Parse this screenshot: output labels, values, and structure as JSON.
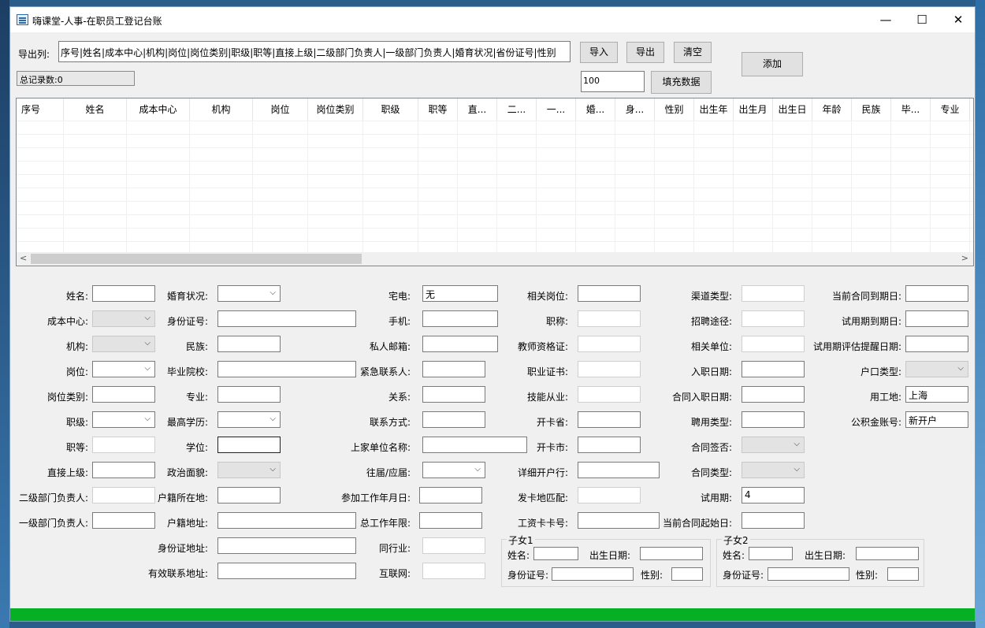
{
  "window": {
    "title": "嗨课堂-人事-在职员工登记台账",
    "min_glyph": "—",
    "max_glyph": "☐",
    "close_glyph": "✕"
  },
  "top": {
    "export_cols_label": "导出列:",
    "export_cols_value": "序号|姓名|成本中心|机构|岗位|岗位类别|职级|职等|直接上级|二级部门负责人|一级部门负责人|婚育状况|省份证号|性别",
    "import_btn": "导入",
    "export_btn": "导出",
    "clear_btn": "清空",
    "add_btn": "添加",
    "total_label": "总记录数:0",
    "count_value": "100",
    "fill_btn": "填充数据"
  },
  "grid": {
    "columns": [
      "序号",
      "姓名",
      "成本中心",
      "机构",
      "岗位",
      "岗位类别",
      "职级",
      "职等",
      "直...",
      "二...",
      "一...",
      "婚...",
      "身...",
      "性别",
      "出生年",
      "出生月",
      "出生日",
      "年龄",
      "民族",
      "毕...",
      "专业"
    ],
    "scroll_left": "<",
    "scroll_right": ">"
  },
  "form": {
    "c1": [
      "姓名:",
      "成本中心:",
      "机构:",
      "岗位:",
      "岗位类别:",
      "职级:",
      "职等:",
      "直接上级:",
      "二级部门负责人:",
      "一级部门负责人:"
    ],
    "c2": [
      "婚育状况:",
      "身份证号:",
      "民族:",
      "毕业院校:",
      "专业:",
      "最高学历:",
      "学位:",
      "政治面貌:",
      "户籍所在地:",
      "户籍地址:",
      "身份证地址:",
      "有效联系地址:"
    ],
    "c3": [
      "宅电:",
      "手机:",
      "私人邮箱:",
      "紧急联系人:",
      "关系:",
      "联系方式:",
      "上家单位名称:",
      "往届/应届:",
      "参加工作年月日:",
      "总工作年限:",
      "同行业:",
      "互联网:"
    ],
    "c4": [
      "相关岗位:",
      "职称:",
      "教师资格证:",
      "职业证书:",
      "技能从业:",
      "开卡省:",
      "开卡市:",
      "详细开户行:",
      "发卡地匹配:",
      "工资卡卡号:"
    ],
    "c5": [
      "渠道类型:",
      "招聘途径:",
      "相关单位:",
      "入职日期:",
      "合同入职日期:",
      "聘用类型:",
      "合同签否:",
      "合同类型:",
      "试用期:",
      "当前合同起始日:"
    ],
    "c6": [
      "当前合同到期日:",
      "试用期到期日:",
      "试用期评估提醒日期:",
      "户口类型:",
      "用工地:",
      "公积金账号:"
    ],
    "home_phone_value": "无",
    "probation_value": "4",
    "work_place_value": "上海",
    "fund_value": "新开户",
    "chevron": "⌵"
  },
  "child1": {
    "title": "子女1",
    "name_label": "姓名:",
    "birth_label": "出生日期:",
    "id_label": "身份证号:",
    "gender_label": "性别:"
  },
  "child2": {
    "title": "子女2",
    "name_label": "姓名:",
    "birth_label": "出生日期:",
    "id_label": "身份证号:",
    "gender_label": "性别:"
  }
}
